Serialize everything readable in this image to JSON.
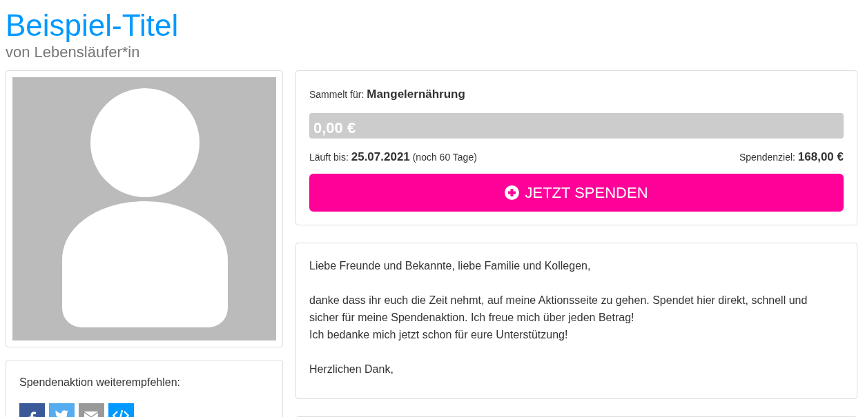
{
  "title": "Beispiel-Titel",
  "subtitle": "von Lebensläufer*in",
  "campaign": {
    "collects_for_label": "Sammelt für:",
    "collects_for": "Mangelernährung",
    "progress": {
      "level": 0,
      "amount": "0,00 €"
    },
    "runs_until_label": "Läuft bis:",
    "runs_until": "25.07.2021",
    "days_left": "(noch 60 Tage)",
    "goal_label": "Spendenziel:",
    "goal": "168,00 €",
    "donate_button": "JETZT SPENDEN"
  },
  "share": {
    "heading": "Spendenaktion weiterempfehlen:",
    "buttons": [
      {
        "kind": "facebook",
        "color": "#3b5998"
      },
      {
        "kind": "twitter",
        "color": "#55acee"
      },
      {
        "kind": "mail",
        "color": "#999999"
      },
      {
        "kind": "embed",
        "color": "#0099ff"
      }
    ]
  },
  "message": {
    "paragraphs": [
      [
        "Liebe Freunde und Bekannte, liebe Familie und Kollegen,"
      ],
      [
        "danke dass ihr euch die Zeit nehmt, auf meine Aktionsseite zu gehen. Spendet hier direkt, schnell und sicher für meine Spendenaktion. Ich freue mich über jeden Betrag!",
        "Ich bedanke mich jetzt schon für eure Unterstützung!"
      ],
      [
        "Herzlichen Dank,"
      ]
    ]
  }
}
